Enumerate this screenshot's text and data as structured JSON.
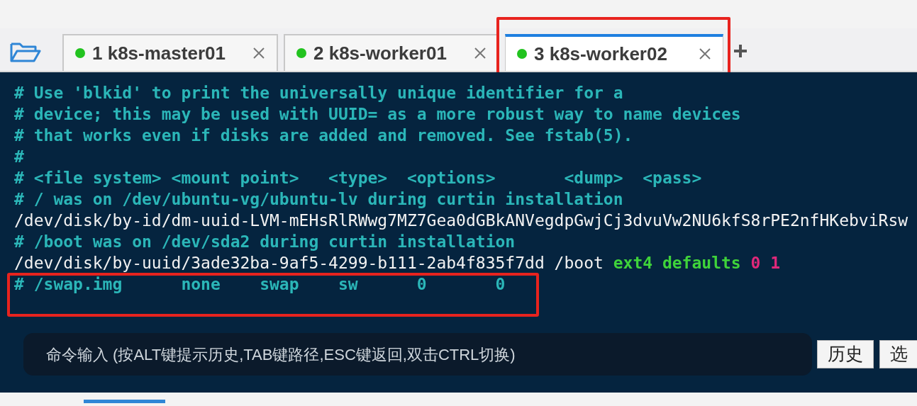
{
  "tabs": [
    {
      "label": "1 k8s-master01",
      "connected": true,
      "selected": false,
      "highlighted": false
    },
    {
      "label": "2 k8s-worker01",
      "connected": true,
      "selected": false,
      "highlighted": false
    },
    {
      "label": "3 k8s-worker02",
      "connected": true,
      "selected": true,
      "highlighted": true
    }
  ],
  "terminal": {
    "lines": [
      {
        "highlighted": false,
        "segments": [
          {
            "kind": "comment",
            "text": "# Use 'blkid' to print the universally unique identifier for a"
          }
        ]
      },
      {
        "highlighted": false,
        "segments": [
          {
            "kind": "comment",
            "text": "# device; this may be used with UUID= as a more robust way to name devices"
          }
        ]
      },
      {
        "highlighted": false,
        "segments": [
          {
            "kind": "comment",
            "text": "# that works even if disks are added and removed. See fstab(5)."
          }
        ]
      },
      {
        "highlighted": false,
        "segments": [
          {
            "kind": "comment",
            "text": "#"
          }
        ]
      },
      {
        "highlighted": false,
        "segments": [
          {
            "kind": "comment",
            "text": "# <file system> <mount point>   <type>  <options>       <dump>  <pass>"
          }
        ]
      },
      {
        "highlighted": false,
        "segments": [
          {
            "kind": "comment",
            "text": "# / was on /dev/ubuntu-vg/ubuntu-lv during curtin installation"
          }
        ]
      },
      {
        "highlighted": false,
        "segments": [
          {
            "kind": "plain",
            "text": "/dev/disk/by-id/dm-uuid-LVM-mEHsRlRWwg7MZ7Gea0dGBkANVegdpGwjCj3dvuVw2NU6kfS8rPE2nfHKebviRsw"
          }
        ]
      },
      {
        "highlighted": false,
        "segments": [
          {
            "kind": "comment",
            "text": "# /boot was on /dev/sda2 during curtin installation"
          }
        ]
      },
      {
        "highlighted": false,
        "segments": [
          {
            "kind": "plain",
            "text": "/dev/disk/by-uuid/3ade32ba-9af5-4299-b111-2ab4f835f7dd /boot "
          },
          {
            "kind": "keyword",
            "text": "ext4 defaults "
          },
          {
            "kind": "number",
            "text": "0 1"
          }
        ]
      },
      {
        "highlighted": true,
        "segments": [
          {
            "kind": "comment",
            "text": "# /swap.img      none    swap    sw      0       0"
          }
        ]
      }
    ]
  },
  "command_input": {
    "placeholder": "命令输入 (按ALT键提示历史,TAB键路径,ESC键返回,双击CTRL切换)"
  },
  "buttons": [
    "历史",
    "选"
  ]
}
